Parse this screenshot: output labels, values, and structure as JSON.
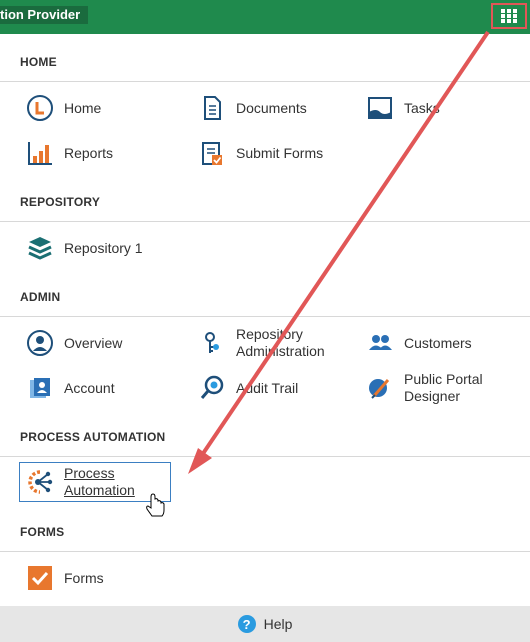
{
  "header": {
    "app_title": "tion Provider",
    "apps_button": "apps-grid"
  },
  "sections": {
    "home": {
      "title": "HOME",
      "items": [
        {
          "label": "Home",
          "icon": "home-icon"
        },
        {
          "label": "Documents",
          "icon": "documents-icon"
        },
        {
          "label": "Tasks",
          "icon": "tasks-icon"
        },
        {
          "label": "Reports",
          "icon": "reports-icon"
        },
        {
          "label": "Submit Forms",
          "icon": "submit-forms-icon"
        }
      ]
    },
    "repository": {
      "title": "REPOSITORY",
      "items": [
        {
          "label": "Repository 1",
          "icon": "repository-icon"
        }
      ]
    },
    "admin": {
      "title": "ADMIN",
      "items": [
        {
          "label": "Overview",
          "icon": "overview-icon"
        },
        {
          "label": "Repository Administration",
          "icon": "repository-admin-icon"
        },
        {
          "label": "Customers",
          "icon": "customers-icon"
        },
        {
          "label": "Account",
          "icon": "account-icon"
        },
        {
          "label": "Audit Trail",
          "icon": "audit-trail-icon"
        },
        {
          "label": "Public Portal Designer",
          "icon": "portal-designer-icon"
        }
      ]
    },
    "process_automation": {
      "title": "PROCESS AUTOMATION",
      "items": [
        {
          "label": "Process Automation",
          "icon": "process-automation-icon"
        }
      ]
    },
    "forms": {
      "title": "FORMS",
      "items": [
        {
          "label": "Forms",
          "icon": "forms-icon"
        }
      ]
    }
  },
  "footer": {
    "help_label": "Help",
    "help_icon_glyph": "?"
  },
  "colors": {
    "header": "#1f8a4d",
    "annotation": "#e15757",
    "selection": "#3b7fc2",
    "accent_orange": "#e8772e",
    "icon_blue": "#1e4f7a"
  }
}
